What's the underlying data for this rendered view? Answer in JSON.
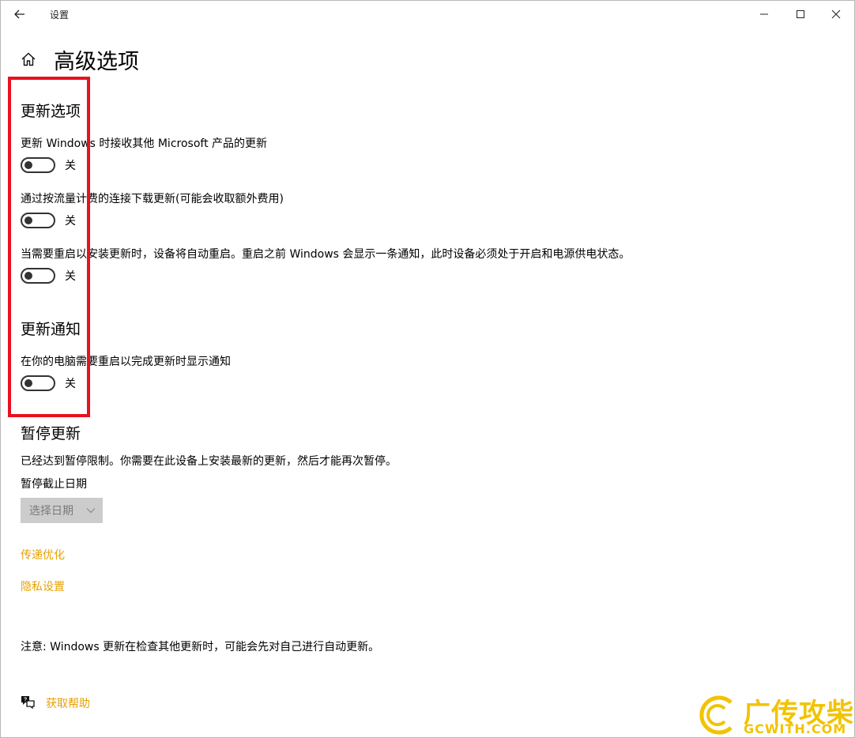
{
  "window": {
    "title": "设置"
  },
  "page": {
    "title": "高级选项"
  },
  "update_options": {
    "heading": "更新选项",
    "items": [
      {
        "label": "更新 Windows 时接收其他 Microsoft 产品的更新",
        "state": "关"
      },
      {
        "label": "通过按流量计费的连接下载更新(可能会收取额外费用)",
        "state": "关"
      },
      {
        "label": "当需要重启以安装更新时，设备将自动重启。重启之前 Windows 会显示一条通知，此时设备必须处于开启和电源供电状态。",
        "state": "关"
      }
    ]
  },
  "update_notifications": {
    "heading": "更新通知",
    "items": [
      {
        "label": "在你的电脑需要重启以完成更新时显示通知",
        "state": "关"
      }
    ]
  },
  "pause_updates": {
    "heading": "暂停更新",
    "message": "已经达到暂停限制。你需要在此设备上安装最新的更新，然后才能再次暂停。",
    "date_label": "暂停截止日期",
    "date_select": "选择日期"
  },
  "links": {
    "delivery_optimization": "传递优化",
    "privacy_settings": "隐私设置"
  },
  "note": "注意: Windows 更新在检查其他更新时，可能会先对自己进行自动更新。",
  "help": {
    "label": "获取帮助"
  },
  "watermark": {
    "cn": "广传攻柴",
    "en": "GCWITH.COM"
  },
  "colors": {
    "link": "#e8a000",
    "highlight": "#e8111f",
    "watermark": "#f2c300"
  }
}
